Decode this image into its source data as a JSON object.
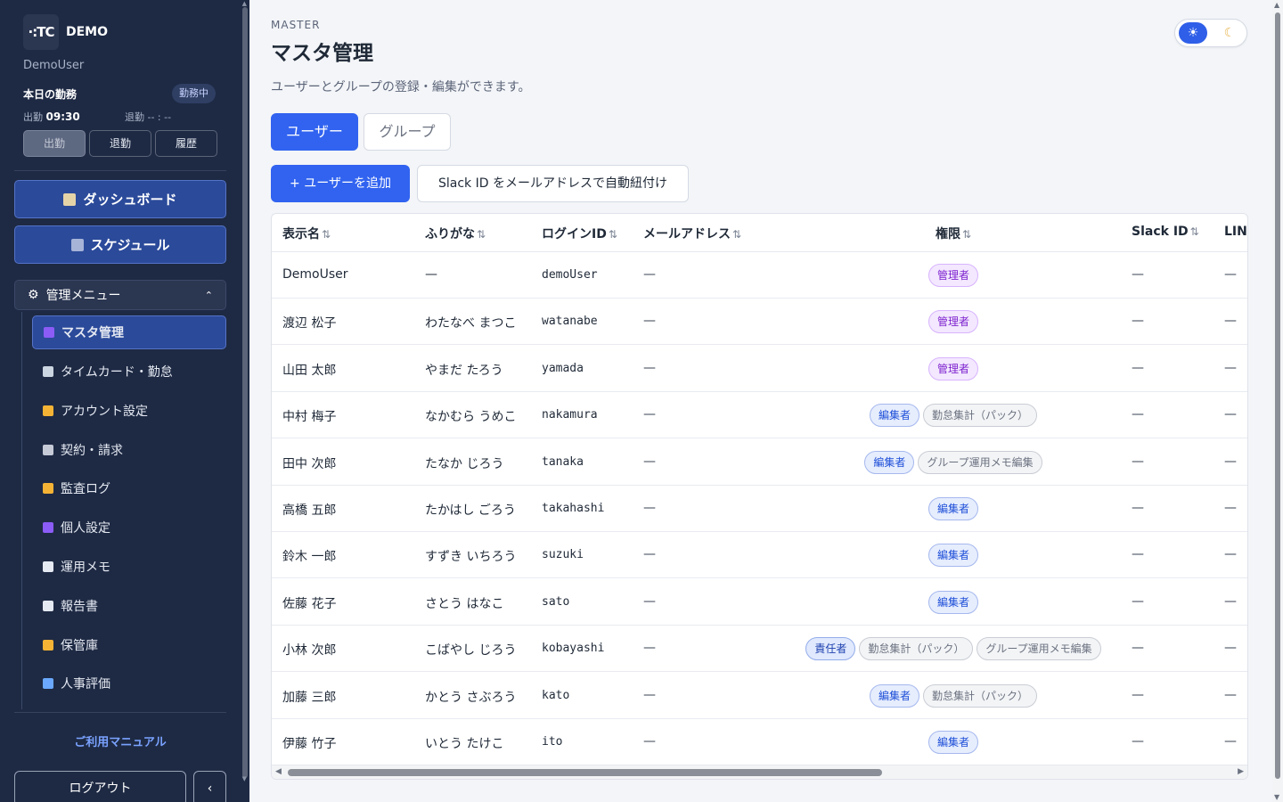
{
  "sidebar": {
    "logo_mark": "·:TC",
    "brand": "DEMO",
    "username": "DemoUser",
    "today_label": "本日の勤務",
    "status_badge": "勤務中",
    "clock_in_label": "出勤",
    "clock_in_time": "09:30",
    "clock_out_label": "退勤",
    "clock_out_time": "-- : --",
    "btn_clock_in": "出勤",
    "btn_clock_out": "退勤",
    "btn_history": "履歴",
    "dashboard": "ダッシュボード",
    "schedule": "スケジュール",
    "admin_menu": "管理メニュー",
    "menu_items": [
      {
        "label": "マスタ管理",
        "icon": "users-icon",
        "color": "#8b5cf6"
      },
      {
        "label": "タイムカード・勤怠",
        "icon": "stopwatch-icon",
        "color": "#cbd5e1"
      },
      {
        "label": "アカウント設定",
        "icon": "key-icon",
        "color": "#f5b335"
      },
      {
        "label": "契約・請求",
        "icon": "ledger-icon",
        "color": "#c5cad6"
      },
      {
        "label": "監査ログ",
        "icon": "notebook-icon",
        "color": "#f5b335"
      },
      {
        "label": "個人設定",
        "icon": "person-icon",
        "color": "#8b5cf6"
      },
      {
        "label": "運用メモ",
        "icon": "memo-icon",
        "color": "#e5e9f2"
      },
      {
        "label": "報告書",
        "icon": "document-icon",
        "color": "#e5e9f2"
      },
      {
        "label": "保管庫",
        "icon": "folder-icon",
        "color": "#f5b335"
      },
      {
        "label": "人事評価",
        "icon": "chart-icon",
        "color": "#6aa9ff"
      }
    ],
    "manual_link": "ご利用マニュアル",
    "logout": "ログアウト",
    "collapse": "‹"
  },
  "main": {
    "eyebrow": "MASTER",
    "title": "マスタ管理",
    "description": "ユーザーとグループの登録・編集ができます。",
    "tabs": [
      "ユーザー",
      "グループ"
    ],
    "add_user": "+ ユーザーを追加",
    "slack_autolink": "Slack ID をメールアドレスで自動紐付け",
    "columns": [
      "表示名",
      "ふりがな",
      "ログインID",
      "メールアドレス",
      "権限",
      "Slack ID",
      "LINE"
    ],
    "sort_glyph": "⇅",
    "rows": [
      {
        "name": "DemoUser",
        "kana": "—",
        "login": "demoUser",
        "email": "—",
        "roles": [
          {
            "t": "管理者",
            "k": "admin"
          }
        ],
        "slack": "—",
        "line": "—"
      },
      {
        "name": "渡辺 松子",
        "kana": "わたなべ まつこ",
        "login": "watanabe",
        "email": "—",
        "roles": [
          {
            "t": "管理者",
            "k": "admin"
          }
        ],
        "slack": "—",
        "line": "—"
      },
      {
        "name": "山田 太郎",
        "kana": "やまだ たろう",
        "login": "yamada",
        "email": "—",
        "roles": [
          {
            "t": "管理者",
            "k": "admin"
          }
        ],
        "slack": "—",
        "line": "—"
      },
      {
        "name": "中村 梅子",
        "kana": "なかむら うめこ",
        "login": "nakamura",
        "email": "—",
        "roles": [
          {
            "t": "編集者",
            "k": "editor"
          },
          {
            "t": "勤怠集計（パック）",
            "k": "perm"
          }
        ],
        "slack": "—",
        "line": "—"
      },
      {
        "name": "田中 次郎",
        "kana": "たなか じろう",
        "login": "tanaka",
        "email": "—",
        "roles": [
          {
            "t": "編集者",
            "k": "editor"
          },
          {
            "t": "グループ運用メモ編集",
            "k": "perm"
          }
        ],
        "slack": "—",
        "line": "—"
      },
      {
        "name": "高橋 五郎",
        "kana": "たかはし ごろう",
        "login": "takahashi",
        "email": "—",
        "roles": [
          {
            "t": "編集者",
            "k": "editor"
          }
        ],
        "slack": "—",
        "line": "—"
      },
      {
        "name": "鈴木 一郎",
        "kana": "すずき いちろう",
        "login": "suzuki",
        "email": "—",
        "roles": [
          {
            "t": "編集者",
            "k": "editor"
          }
        ],
        "slack": "—",
        "line": "—"
      },
      {
        "name": "佐藤 花子",
        "kana": "さとう はなこ",
        "login": "sato",
        "email": "—",
        "roles": [
          {
            "t": "編集者",
            "k": "editor"
          }
        ],
        "slack": "—",
        "line": "—"
      },
      {
        "name": "小林 次郎",
        "kana": "こばやし じろう",
        "login": "kobayashi",
        "email": "—",
        "roles": [
          {
            "t": "責任者",
            "k": "owner"
          },
          {
            "t": "勤怠集計（パック）",
            "k": "perm"
          },
          {
            "t": "グループ運用メモ編集",
            "k": "perm"
          }
        ],
        "slack": "—",
        "line": "—"
      },
      {
        "name": "加藤 三郎",
        "kana": "かとう さぶろう",
        "login": "kato",
        "email": "—",
        "roles": [
          {
            "t": "編集者",
            "k": "editor"
          },
          {
            "t": "勤怠集計（パック）",
            "k": "perm"
          }
        ],
        "slack": "—",
        "line": "—"
      },
      {
        "name": "伊藤 竹子",
        "kana": "いとう たけこ",
        "login": "ito",
        "email": "—",
        "roles": [
          {
            "t": "編集者",
            "k": "editor"
          }
        ],
        "slack": "—",
        "line": "—"
      }
    ]
  },
  "theme": {
    "sun_icon": "☀",
    "moon_icon": "☾"
  }
}
